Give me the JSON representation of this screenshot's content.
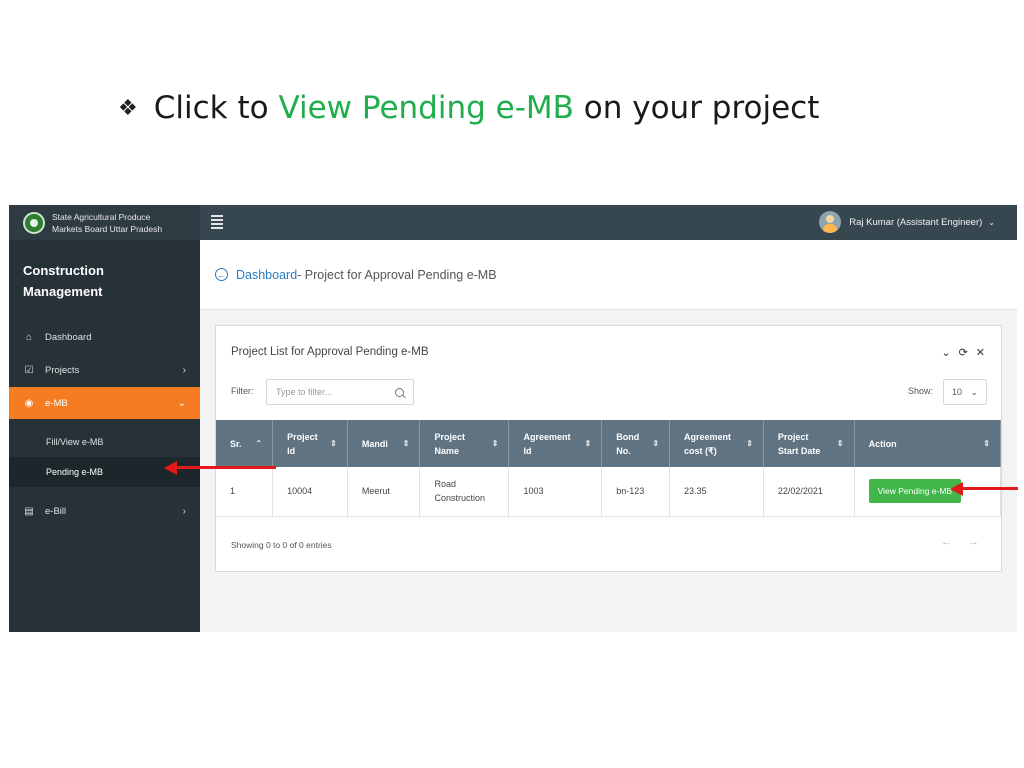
{
  "slide": {
    "heading_prefix": "Click to",
    "heading_highlight": "View Pending e-MB",
    "heading_suffix": "on your project"
  },
  "app": {
    "brand_line1": "State Agricultural Produce",
    "brand_line2": "Markets Board Uttar Pradesh",
    "user_name": "Raj Kumar (Assistant Engineer)"
  },
  "sidebar": {
    "section_title": "Construction Management",
    "items": [
      {
        "label": "Dashboard",
        "icon": "home-icon"
      },
      {
        "label": "Projects",
        "icon": "checkbox-icon"
      },
      {
        "label": "e-MB",
        "icon": "radio-icon"
      },
      {
        "label": "e-Bill",
        "icon": "clipboard-icon"
      }
    ],
    "sub_items": [
      {
        "label": "Fill/View e-MB"
      },
      {
        "label": "Pending e-MB"
      }
    ]
  },
  "breadcrumb": {
    "link": "Dashboard",
    "rest": " - Project for Approval Pending e-MB"
  },
  "card": {
    "title": "Project List for Approval Pending e-MB",
    "filter_label": "Filter:",
    "filter_placeholder": "Type to filter...",
    "show_label": "Show:",
    "show_value": "10",
    "footer_info": "Showing 0 to 0 of 0 entries"
  },
  "table": {
    "headers": [
      "Sr.",
      "Project Id",
      "Mandi",
      "Project Name",
      "Agreement Id",
      "Bond No.",
      "Agreement cost (₹)",
      "Project Start Date",
      "Action"
    ],
    "rows": [
      {
        "sr": "1",
        "project_id": "10004",
        "mandi": "Meerut",
        "project_name": "Road Construction",
        "agreement_id": "1003",
        "bond_no": "bn-123",
        "agreement_cost": "23.35",
        "start_date": "22/02/2021",
        "action_label": "View Pending e-MB"
      }
    ]
  },
  "colors": {
    "highlight": "#1fae4b",
    "topbar": "#37474f",
    "sidebar": "#263238",
    "active_nav": "#f57c20",
    "table_header": "#5f7383",
    "button": "#43b649",
    "arrow": "#e3191c",
    "link": "#2b7cc0"
  }
}
